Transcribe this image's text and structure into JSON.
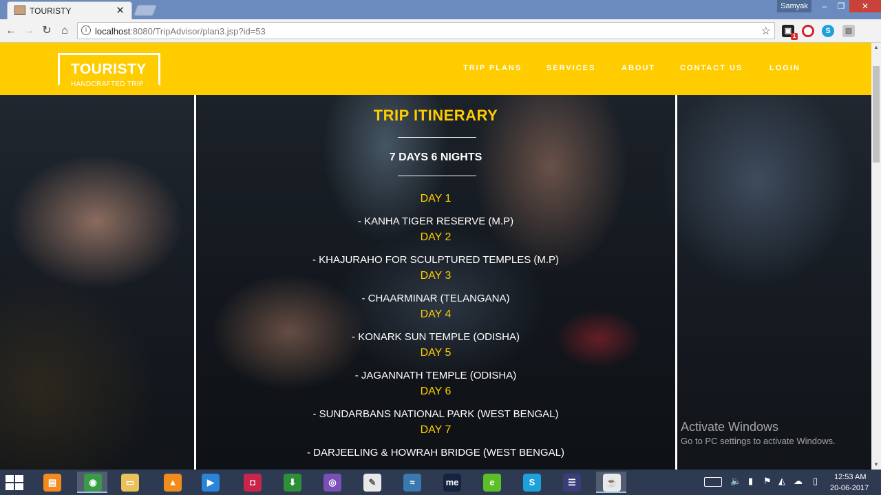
{
  "browser": {
    "tab_title": "TOURISTY",
    "tab_close": "✕",
    "user_label": "Samyak",
    "url_host": "localhost",
    "url_rest": ":8080/TripAdvisor/plan3.jsp?id=53"
  },
  "site": {
    "brand": "TOURISTY",
    "tagline": "HANDCRAFTED TRIP",
    "nav": [
      "TRIP PLANS",
      "SERVICES",
      "ABOUT",
      "CONTACT US",
      "LOGIN"
    ]
  },
  "itinerary": {
    "title": "TRIP ITINERARY",
    "duration": "7 DAYS 6 NIGHTS",
    "days": [
      {
        "day": "DAY 1",
        "place": "- KANHA TIGER RESERVE (M.P)"
      },
      {
        "day": "DAY 2",
        "place": "- KHAJURAHO FOR SCULPTURED TEMPLES (M.P)"
      },
      {
        "day": "DAY 3",
        "place": "- CHAARMINAR (TELANGANA)"
      },
      {
        "day": "DAY 4",
        "place": "- KONARK SUN TEMPLE (ODISHA)"
      },
      {
        "day": "DAY 5",
        "place": "- JAGANNATH TEMPLE (ODISHA)"
      },
      {
        "day": "DAY 6",
        "place": "- SUNDARBANS NATIONAL PARK (WEST BENGAL)"
      },
      {
        "day": "DAY 7",
        "place": "- DARJEELING & HOWRAH BRIDGE (WEST BENGAL)"
      }
    ]
  },
  "watermark": {
    "line1": "Activate Windows",
    "line2": "Go to PC settings to activate Windows."
  },
  "taskbar": {
    "time": "12:53 AM",
    "date": "20-06-2017",
    "apps": [
      {
        "icon": "server-manager-icon",
        "glyph": "▤",
        "color": "#f28a1e"
      },
      {
        "icon": "chrome-icon",
        "glyph": "◉",
        "color": "#3b9a48",
        "active": true
      },
      {
        "icon": "file-explorer-icon",
        "glyph": "▭",
        "color": "#e8c15a"
      },
      {
        "icon": "vlc-icon",
        "glyph": "▲",
        "color": "#f08c1c"
      },
      {
        "icon": "media-player-icon",
        "glyph": "▶",
        "color": "#2a84d8"
      },
      {
        "icon": "screen-recorder-icon",
        "glyph": "◘",
        "color": "#c9254b"
      },
      {
        "icon": "download-manager-icon",
        "glyph": "⬇",
        "color": "#2e8f3a"
      },
      {
        "icon": "tor-browser-icon",
        "glyph": "◎",
        "color": "#7a4fb8"
      },
      {
        "icon": "notepad-icon",
        "glyph": "✎",
        "color": "#e8e8e8"
      },
      {
        "icon": "mysql-icon",
        "glyph": "≈",
        "color": "#3a78b0"
      },
      {
        "icon": "me-app-icon",
        "glyph": "me",
        "color": "#16233f"
      },
      {
        "icon": "feed-app-icon",
        "glyph": "e",
        "color": "#5bbf2a"
      },
      {
        "icon": "skype-icon",
        "glyph": "S",
        "color": "#1ea0db"
      },
      {
        "icon": "eclipse-icon",
        "glyph": "☰",
        "color": "#3a3d78"
      },
      {
        "icon": "java-icon",
        "glyph": "☕",
        "color": "#e9e9e9",
        "active": true
      }
    ]
  }
}
